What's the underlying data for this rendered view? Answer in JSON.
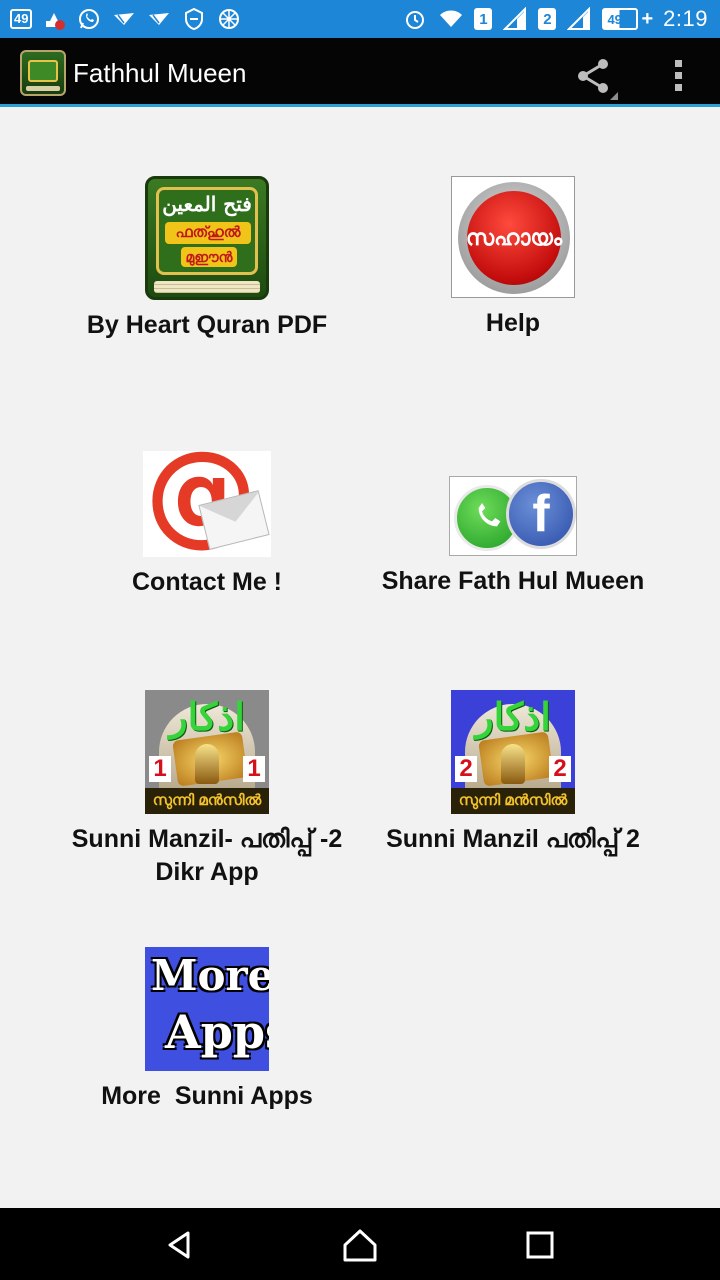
{
  "status_bar": {
    "notification_count": "49",
    "sim1": "1",
    "sim2": "2",
    "battery": "49%",
    "time": "2:19"
  },
  "header": {
    "title": "Fathhul Mueen",
    "share_icon": "share-icon",
    "overflow_icon": "overflow-menu-icon"
  },
  "grid": {
    "items": [
      {
        "label": "By Heart Quran PDF",
        "icon": "quran-book-icon",
        "icon_arabic": "فتح المعين",
        "icon_line1": "ഫത്ഹുൽ",
        "icon_line2": "മുഈൻ"
      },
      {
        "label": "Help",
        "icon": "help-button-icon",
        "icon_text": "സഹായം"
      },
      {
        "label": "Contact Me !",
        "icon": "email-at-icon"
      },
      {
        "label": "Share Fath Hul Mueen",
        "icon": "share-social-icon"
      },
      {
        "label": "Sunni Manzil- പതിപ്പ് -2 Dikr App",
        "icon": "sunni-manzil-1-icon",
        "icon_arabic": "اذكار",
        "icon_number": "1",
        "icon_caption": "സുന്നി മൻസിൽ"
      },
      {
        "label": "Sunni Manzil പതിപ്പ് 2",
        "icon": "sunni-manzil-2-icon",
        "icon_arabic": "اذكار",
        "icon_number": "2",
        "icon_caption": "സുന്നി മൻസിൽ"
      },
      {
        "label": "More  Sunni Apps",
        "icon": "more-apps-icon",
        "icon_line1": "More",
        "icon_line2": "Apps"
      }
    ]
  },
  "nav_bar": {
    "back_icon": "back-triangle-icon",
    "home_icon": "home-icon",
    "recents_icon": "recents-square-icon"
  },
  "colors": {
    "status_bar": "#1e86d6",
    "action_bar": "#050505",
    "action_bar_divider": "#2a9fd8",
    "background": "#f2f2f2",
    "nav_bar": "#000000"
  }
}
